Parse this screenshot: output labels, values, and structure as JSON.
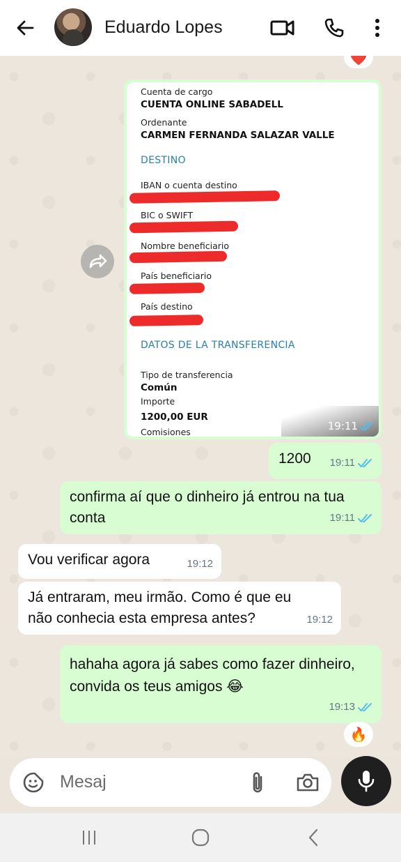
{
  "header": {
    "back_icon": "arrow-left-icon",
    "contact_name": "Eduardo Lopes",
    "video_call_icon": "video-camera-icon",
    "voice_call_icon": "phone-icon",
    "menu_icon": "more-vertical-icon"
  },
  "chat": {
    "top_reaction": "❤️",
    "image_message": {
      "fields": {
        "cuenta_cargo_label": "Cuenta de cargo",
        "cuenta_cargo_value": "CUENTA ONLINE SABADELL",
        "ordenante_label": "Ordenante",
        "ordenante_value": "CARMEN FERNANDA SALAZAR VALLE",
        "destino_heading": "DESTINO",
        "iban_label": "IBAN o cuenta destino",
        "bic_label": "BIC o SWIFT",
        "nombre_label": "Nombre beneficiario",
        "pais_benef_label": "País beneficiario",
        "pais_destino_label": "País destino",
        "datos_heading": "DATOS DE LA TRANSFERENCIA",
        "tipo_label": "Tipo de transferencia",
        "tipo_value": "Común",
        "importe_label": "Importe",
        "importe_value": "1200,00 EUR",
        "comisiones_label": "Comisiones"
      },
      "time": "19:11",
      "status": "read"
    },
    "messages": [
      {
        "direction": "out",
        "text": "1200",
        "time": "19:11",
        "status": "read"
      },
      {
        "direction": "out",
        "text": "confirma aí que o dinheiro já entrou na tua conta",
        "time": "19:11",
        "status": "read"
      },
      {
        "direction": "in",
        "text": "Vou verificar agora",
        "time": "19:12"
      },
      {
        "direction": "in",
        "text": "Já entraram, meu irmão. Como é que eu não conhecia esta empresa antes?",
        "time": "19:12"
      },
      {
        "direction": "out",
        "text": "hahaha agora já sabes como fazer dinheiro, convida os teus amigos 😂",
        "time": "19:13",
        "status": "read"
      }
    ],
    "bottom_reaction": "🔥"
  },
  "composer": {
    "placeholder": "Mesaj",
    "sticker_icon": "sticker-icon",
    "attach_icon": "paperclip-icon",
    "camera_icon": "camera-icon",
    "mic_icon": "microphone-icon"
  },
  "nav": {
    "recents_icon": "recents-icon",
    "home_icon": "home-icon",
    "back_icon": "back-chevron-icon"
  },
  "colors": {
    "outgoing_bubble": "#d9fdd3",
    "incoming_bubble": "#ffffff",
    "read_ticks": "#53bdeb",
    "chat_background": "#ece6dd"
  }
}
